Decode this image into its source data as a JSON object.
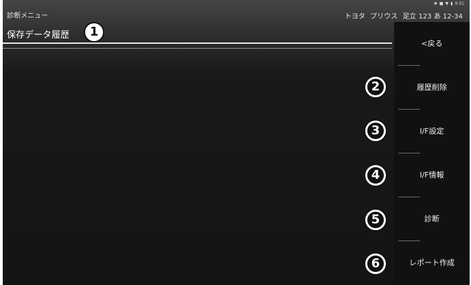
{
  "statusbar": {
    "icons": [
      "bluetooth-icon",
      "signal-icon",
      "wifi-icon",
      "battery-icon"
    ],
    "time": "9:51"
  },
  "header": {
    "menu_title": "診断メニュー",
    "maker": "トヨタ",
    "model": "プリウス",
    "plate": "足立 123 あ 12-34"
  },
  "page": {
    "title": "保存データ履歴"
  },
  "sidebar": {
    "back": "<戻る",
    "delete_history": "履歴削除",
    "if_settings": "I/F設定",
    "if_info": "I/F情報",
    "diagnosis": "診断",
    "create_report": "レポート作成"
  },
  "callouts": [
    "1",
    "2",
    "3",
    "4",
    "5",
    "6"
  ],
  "colors": {
    "background": "#141414",
    "sidebar": "#111111",
    "text": "#ffffff",
    "divider": "#e6e6e6"
  }
}
